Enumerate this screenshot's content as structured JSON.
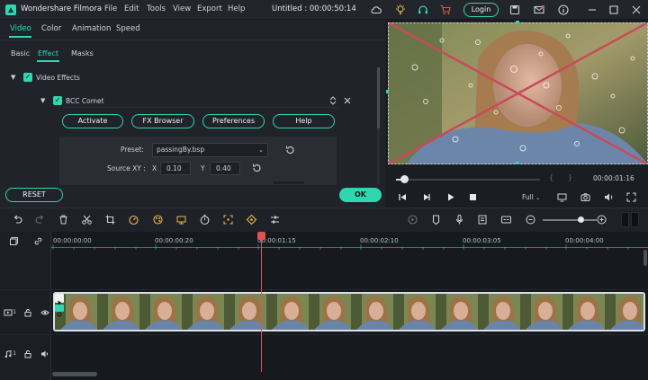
{
  "app": {
    "name": "Wondershare Filmora",
    "window_title": "Untitled : 00:00:50:14"
  },
  "menu": [
    "File",
    "Edit",
    "Tools",
    "View",
    "Export",
    "Help"
  ],
  "login_label": "Login",
  "tabs": [
    "Video",
    "Color",
    "Animation",
    "Speed"
  ],
  "subtabs": [
    "Basic",
    "Effect",
    "Masks"
  ],
  "video_effects": {
    "section_label": "Video Effects",
    "effect_name": "BCC Comet",
    "buttons": [
      "Activate",
      "FX Browser",
      "Preferences",
      "Help"
    ],
    "preset_label": "Preset:",
    "preset_value": "passingBy.bsp",
    "source_xy_label": "Source XY :",
    "x_label": "X",
    "x_value": "0.10",
    "y_label": "Y",
    "y_value": "0.40"
  },
  "reset_label": "RESET",
  "ok_label": "OK",
  "preview": {
    "timecode": "00:00:01:16",
    "quality": "Full",
    "progress": 0.04
  },
  "timeline": {
    "ruler_ticks": [
      "00:00:00:00",
      "00:00:00:20",
      "00:00:01:15",
      "00:00:02:10",
      "00:00:03:05",
      "00:00:04:00"
    ],
    "video_track_label": "1",
    "audio_track_label": "1"
  },
  "colors": {
    "accent": "#2fd6b1",
    "playhead": "#e35252",
    "cross": "#c94a5a"
  }
}
